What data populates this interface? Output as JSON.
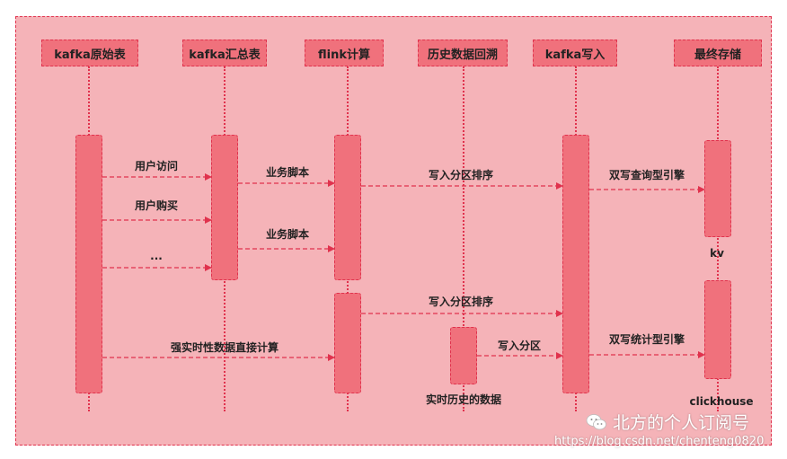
{
  "participants": [
    {
      "id": "kafka_raw",
      "label": "kafka原始表"
    },
    {
      "id": "kafka_agg",
      "label": "kafka汇总表"
    },
    {
      "id": "flink",
      "label": "flink计算"
    },
    {
      "id": "history",
      "label": "历史数据回溯"
    },
    {
      "id": "kafka_write",
      "label": "kafka写入"
    },
    {
      "id": "storage",
      "label": "最终存储"
    }
  ],
  "messages": [
    {
      "from": "kafka_raw",
      "to": "kafka_agg",
      "label": "用户访问"
    },
    {
      "from": "kafka_raw",
      "to": "kafka_agg",
      "label": "用户购买"
    },
    {
      "from": "kafka_raw",
      "to": "kafka_agg",
      "label": "..."
    },
    {
      "from": "kafka_agg",
      "to": "flink",
      "label": "业务脚本"
    },
    {
      "from": "kafka_agg",
      "to": "flink",
      "label": "业务脚本"
    },
    {
      "from": "flink",
      "to": "kafka_write",
      "label": "写入分区排序"
    },
    {
      "from": "flink",
      "to": "kafka_write",
      "label": "写入分区排序"
    },
    {
      "from": "kafka_write",
      "to": "storage",
      "label": "双写查询型引擎"
    },
    {
      "from": "kafka_write",
      "to": "storage",
      "label": "双写统计型引擎"
    },
    {
      "from": "kafka_raw",
      "to": "flink",
      "label": "强实时性数据直接计算"
    },
    {
      "from": "history",
      "to": "kafka_write",
      "label": "写入分区"
    }
  ],
  "notes": {
    "kv": "kv",
    "clickhouse": "clickhouse",
    "realtime_history": "实时历史的数据"
  },
  "watermark": {
    "icon": "wechat-icon",
    "text": "北方的个人订阅号",
    "url": "https://blog.csdn.net/chenteng0820"
  },
  "colors": {
    "background": "#f5b3b8",
    "box_fill": "#f0717c",
    "line": "#e0324d"
  }
}
